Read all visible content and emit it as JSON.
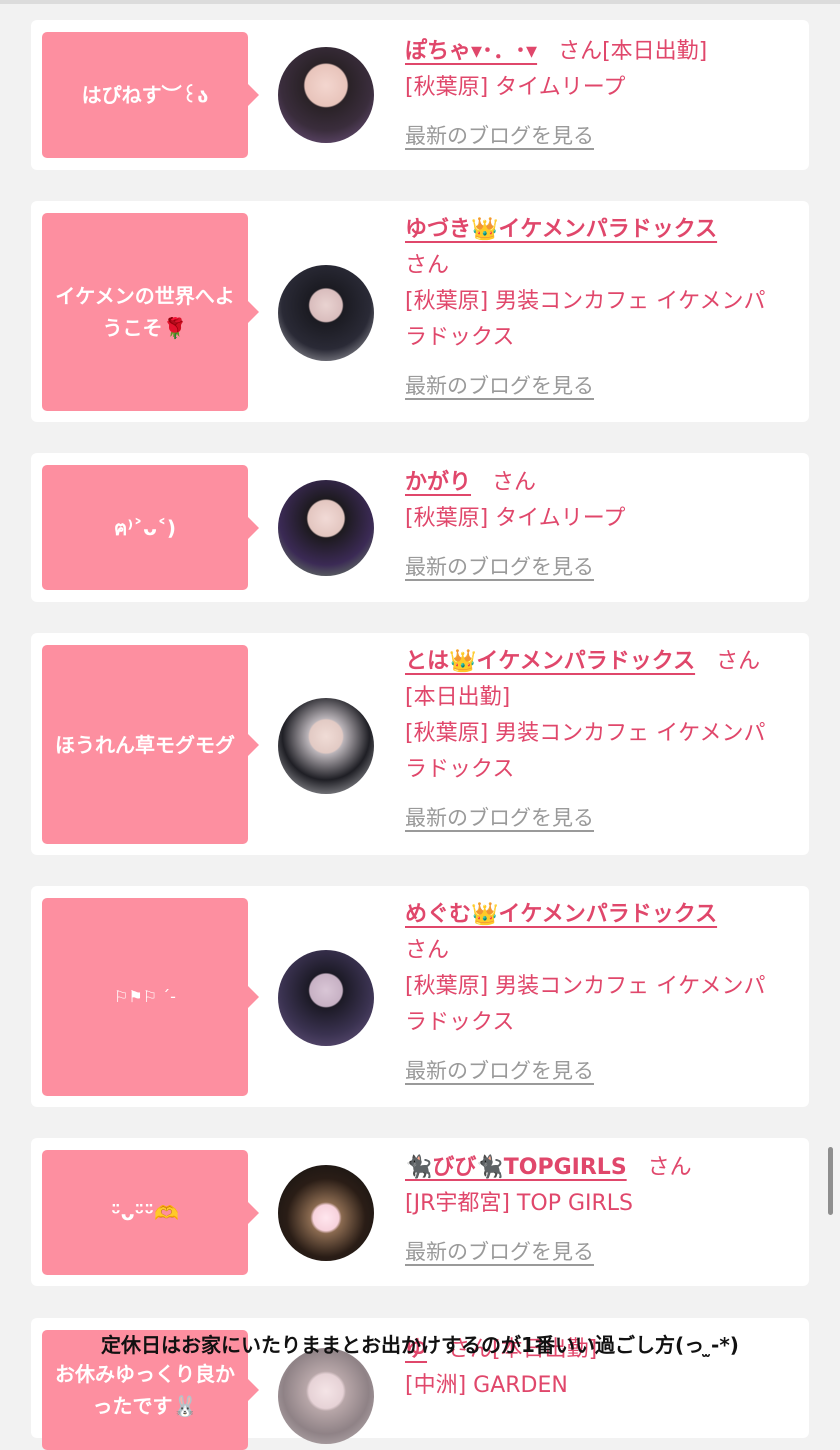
{
  "blog_link_label": "最新のブログを見る",
  "suffix_san": "さん",
  "cards": [
    {
      "message": "はぴねす︶꒰ა",
      "name": "ぽちゃ▾･．･▾",
      "status": "[本日出勤]",
      "shop": "[秋葉原] タイムリープ"
    },
    {
      "message": "イケメンの世界へようこそ🌹",
      "name": "ゆづき👑イケメンパラドックス",
      "status": "",
      "shop": "[秋葉原] 男装コンカフェ イケメンパラドックス"
    },
    {
      "message": "ฅ⁾˃ᴗ˂)",
      "name": "かがり",
      "status": "",
      "shop": "[秋葉原] タイムリープ"
    },
    {
      "message": "ほうれん草モグモグ",
      "name": "とは👑イケメンパラドックス",
      "status": "[本日出勤]",
      "shop": "[秋葉原] 男装コンカフェ イケメンパラドックス"
    },
    {
      "message": "⚐⚑⚐ ´-",
      "name": "めぐむ👑イケメンパラドックス",
      "status": "",
      "shop": "[秋葉原] 男装コンカフェ イケメンパラドックス"
    },
    {
      "message": "ᵕ̈ᴗᵕ̈ᵕ̈🫶",
      "name": "🐈‍⬛びび🐈‍⬛TOPGIRLS",
      "status": "",
      "shop": "[JR宇都宮] TOP GIRLS"
    },
    {
      "message": "お休みゆっくり良かったです🐰",
      "name": "ゆ",
      "status": "[本日出勤]",
      "shop": "[中洲] GARDEN"
    }
  ],
  "overlay_text": "定休日はお家にいたりままとお出かけするのが1番いい過ごし方(っ ̫-*)",
  "colors": {
    "accent": "#e0476b",
    "bubble": "#fd8fa0",
    "muted": "#9a9a9a",
    "background": "#f2f2f2"
  }
}
